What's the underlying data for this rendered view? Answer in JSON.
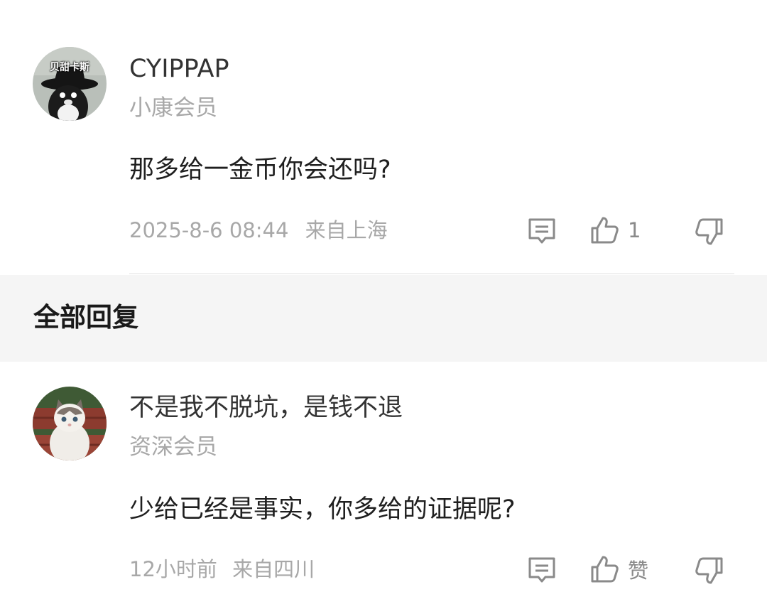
{
  "comment": {
    "username": "CYIPPAP",
    "badge": "小康会员",
    "text": "那多给一金币你会还吗?",
    "time": "2025-8-6 08:44",
    "location": "来自上海",
    "like_count": "1",
    "avatar_text": "贝甜卡斯"
  },
  "section": {
    "title": "全部回复"
  },
  "reply": {
    "username": "不是我不脱坑，是钱不退",
    "badge": "资深会员",
    "text": "少给已经是事实，你多给的证据呢?",
    "time": "12小时前",
    "location": "来自四川",
    "like_label": "赞"
  },
  "icons": {
    "comment": "comment-icon",
    "like": "thumbs-up-icon",
    "dislike": "thumbs-down-icon"
  },
  "colors": {
    "text_primary": "#1f1f1f",
    "text_secondary": "#a8a8a8",
    "section_bg": "#f5f5f5"
  }
}
